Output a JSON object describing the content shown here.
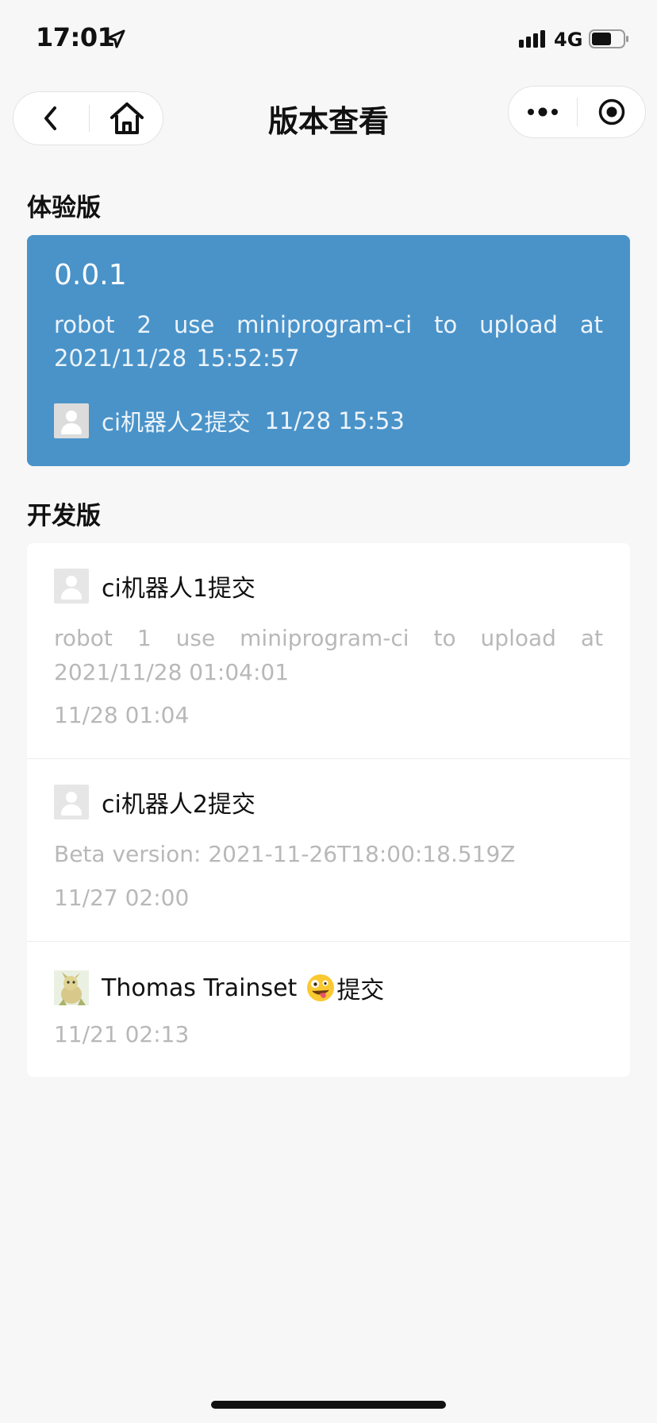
{
  "status": {
    "time": "17:01",
    "network": "4G"
  },
  "nav": {
    "title": "版本查看"
  },
  "trial": {
    "section_title": "体验版",
    "version": "0.0.1",
    "description": "robot 2 use miniprogram-ci to upload at 2021/11/28 15:52:57",
    "submitter": "ci机器人2提交",
    "time": "11/28 15:53"
  },
  "dev": {
    "section_title": "开发版",
    "items": [
      {
        "submitter": "ci机器人1提交",
        "description": "robot 1 use miniprogram-ci to upload at 2021/11/28 01:04:01",
        "time": "11/28 01:04"
      },
      {
        "submitter": "ci机器人2提交",
        "description": "Beta version: 2021-11-26T18:00:18.519Z",
        "time": "11/27 02:00"
      },
      {
        "submitter_name": "Thomas Trainset",
        "submitter_suffix": "提交",
        "time": "11/21 02:13"
      }
    ]
  },
  "colors": {
    "accent": "#4a93c9",
    "background": "#f7f7f7",
    "muted_text": "#b8b8b8"
  },
  "icons": {
    "location": "location-arrow-icon",
    "signal": "signal-bars-icon",
    "battery": "battery-icon",
    "back": "chevron-left-icon",
    "home": "home-icon",
    "more": "more-dots-icon",
    "close": "target-close-icon",
    "avatar_placeholder": "user-placeholder-icon",
    "emoji": "zany-face-emoji"
  }
}
